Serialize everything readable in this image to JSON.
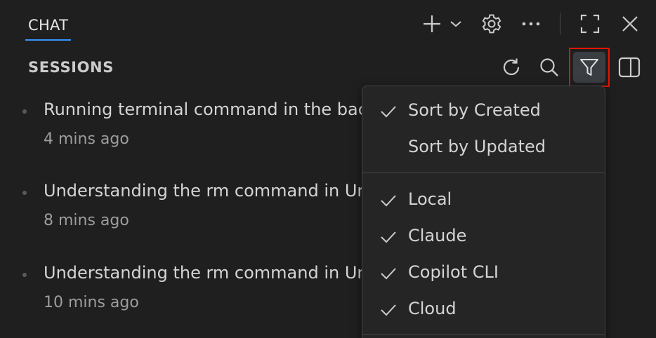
{
  "header": {
    "tab_label": "CHAT",
    "icons": {
      "new": "plus-icon",
      "new_dropdown": "chevron-down-icon",
      "settings": "gear-icon",
      "more": "ellipsis-icon",
      "maximize": "maximize-icon",
      "close": "close-icon"
    }
  },
  "sessions": {
    "title": "SESSIONS",
    "toolbar_icons": [
      "refresh-icon",
      "search-icon",
      "filter-icon",
      "toggle-sidebar-icon"
    ],
    "items": [
      {
        "title": "Running terminal command in the background",
        "time": "4 mins ago"
      },
      {
        "title": "Understanding the rm command in Unix",
        "time": "8 mins ago"
      },
      {
        "title": "Understanding the rm command in Unix",
        "time": "10 mins ago"
      }
    ]
  },
  "filter_menu": {
    "sort_items": [
      {
        "label": "Sort by Created",
        "checked": true
      },
      {
        "label": "Sort by Updated",
        "checked": false
      }
    ],
    "source_items": [
      {
        "label": "Local",
        "checked": true
      },
      {
        "label": "Claude",
        "checked": true
      },
      {
        "label": "Copilot CLI",
        "checked": true
      },
      {
        "label": "Cloud",
        "checked": true
      }
    ]
  },
  "colors": {
    "background": "#1f1f1f",
    "menu_background": "#252526",
    "accent_tab": "#3794ff",
    "highlight_border": "#e51400"
  }
}
